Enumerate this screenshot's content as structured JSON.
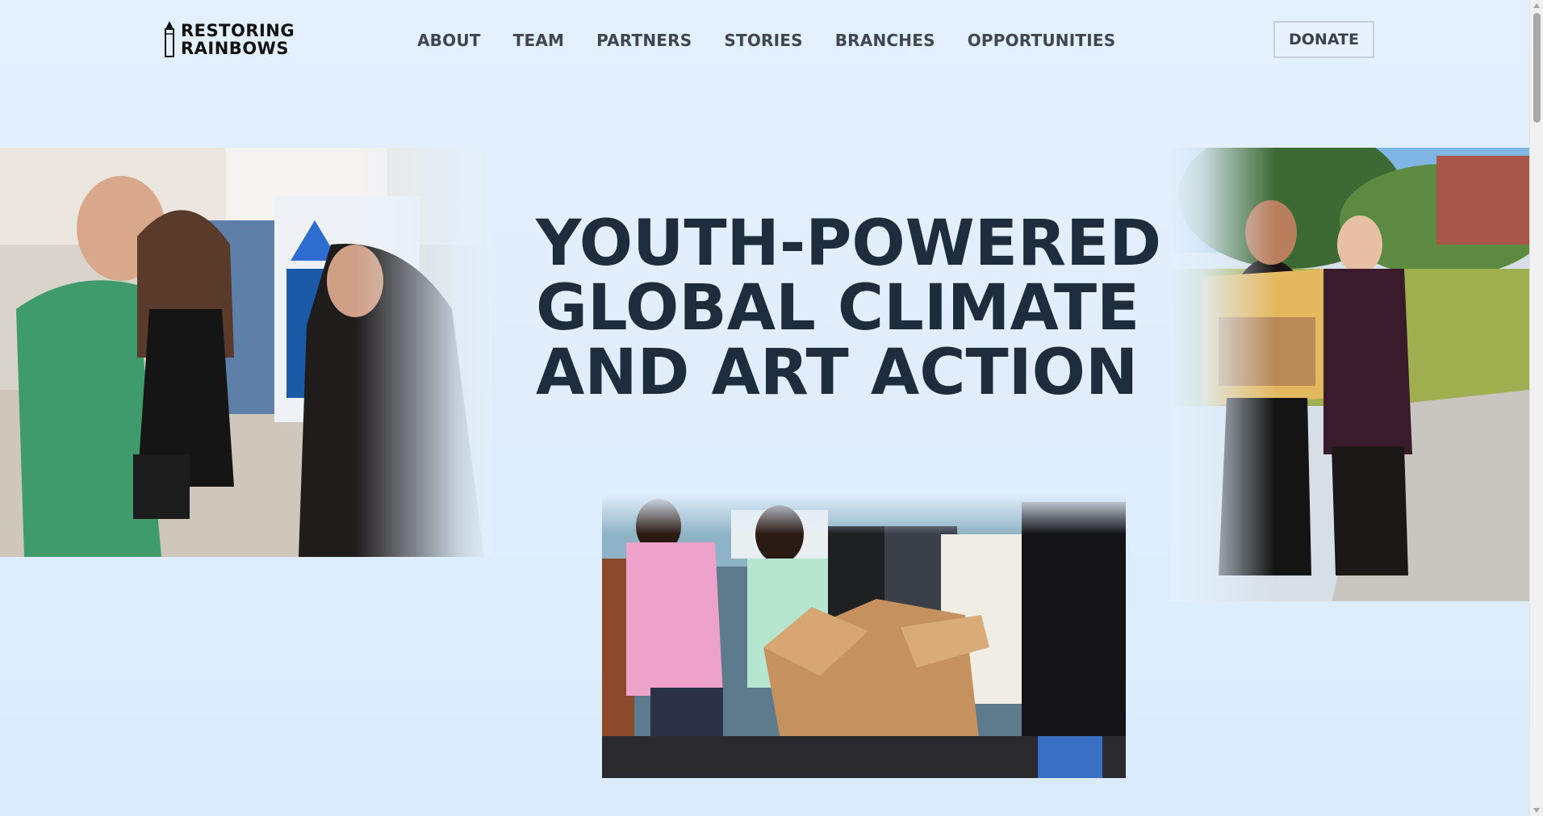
{
  "header": {
    "logo": {
      "line1": "RESTORING",
      "line2": "RAINBOWS"
    },
    "nav": [
      {
        "label": "ABOUT"
      },
      {
        "label": "TEAM"
      },
      {
        "label": "PARTNERS"
      },
      {
        "label": "STORIES"
      },
      {
        "label": "BRANCHES"
      },
      {
        "label": "OPPORTUNITIES"
      }
    ],
    "donate_label": "DONATE"
  },
  "hero": {
    "title_lines": [
      "YOUTH-POWERED",
      "GLOBAL CLIMATE",
      "AND ART ACTION"
    ]
  },
  "photos": {
    "left": {
      "alt": "Volunteers talking at an art fair booth"
    },
    "right": {
      "alt": "Two women holding a donation box outdoors"
    },
    "bottom": {
      "alt": "Students opening a box of art supplies"
    }
  },
  "colors": {
    "background": "#e3f0fd",
    "heading": "#1e2d3b",
    "nav_text": "#3f4650",
    "donate_border": "#c3cfdc"
  },
  "icons": {
    "logo_mark": "pencil-icon",
    "scroll_up": "chevron-up-icon",
    "scroll_down": "chevron-down-icon"
  }
}
